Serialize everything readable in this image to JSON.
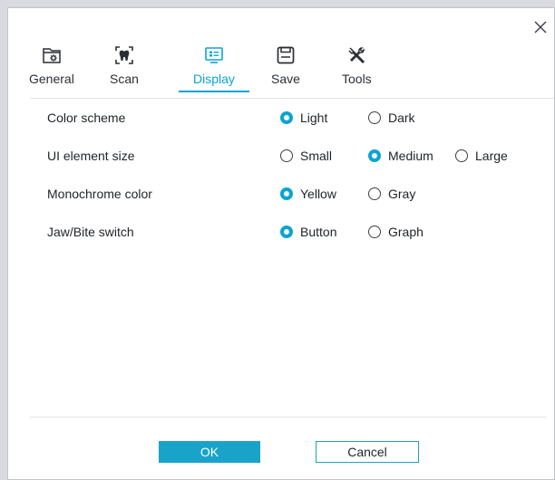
{
  "dialog": {
    "close_icon": "close-icon",
    "accent_color": "#0aa4d3",
    "button_color": "#1aa3c8"
  },
  "tabs": [
    {
      "id": "general",
      "label": "General",
      "icon": "folder-gear-icon",
      "active": false
    },
    {
      "id": "scan",
      "label": "Scan",
      "icon": "tooth-scan-icon",
      "active": false
    },
    {
      "id": "display",
      "label": "Display",
      "icon": "monitor-icon",
      "active": true
    },
    {
      "id": "save",
      "label": "Save",
      "icon": "floppy-disk-icon",
      "active": false
    },
    {
      "id": "tools",
      "label": "Tools",
      "icon": "tools-icon",
      "active": false
    }
  ],
  "settings": [
    {
      "label": "Color scheme",
      "options": [
        "Light",
        "Dark"
      ],
      "selected": "Light"
    },
    {
      "label": "UI element size",
      "options": [
        "Small",
        "Medium",
        "Large"
      ],
      "selected": "Medium"
    },
    {
      "label": "Monochrome color",
      "options": [
        "Yellow",
        "Gray"
      ],
      "selected": "Yellow"
    },
    {
      "label": "Jaw/Bite switch",
      "options": [
        "Button",
        "Graph"
      ],
      "selected": "Button"
    }
  ],
  "buttons": {
    "ok": "OK",
    "cancel": "Cancel"
  }
}
